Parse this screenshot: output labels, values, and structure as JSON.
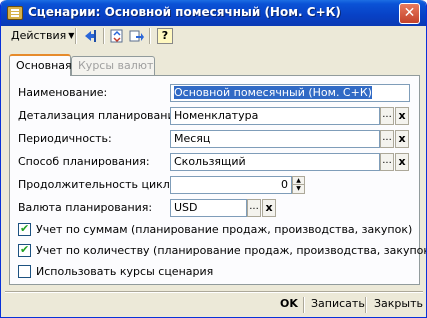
{
  "window": {
    "title": "Сценарии: Основной помесячный (Ном. С+К)",
    "close_glyph": "✕"
  },
  "toolbar": {
    "actions_label": "Действия",
    "help_label": "?"
  },
  "tabs": [
    {
      "label": "Основная",
      "active": true
    },
    {
      "label": "Курсы валют",
      "active": false
    }
  ],
  "form": {
    "name_label": "Наименование:",
    "name_value": "Основной помесячный (Ном. С+К)",
    "detail_label": "Детализация планирования:",
    "detail_value": "Номенклатура",
    "period_label": "Периодичность:",
    "period_value": "Месяц",
    "method_label": "Способ планирования:",
    "method_value": "Скользящий",
    "duration_label": "Продолжительность цикла:",
    "duration_value": "0",
    "currency_label": "Валюта планирования:",
    "currency_value": "USD",
    "ellipsis": "...",
    "clear": "x"
  },
  "checkboxes": [
    {
      "label": "Учет по суммам (планирование продаж, производства, закупок)",
      "checked": true
    },
    {
      "label": "Учет по количеству (планирование продаж, производства, закупок)",
      "checked": true
    },
    {
      "label": "Использовать курсы сценария",
      "checked": false
    }
  ],
  "footer": {
    "ok_label": "OK",
    "save_label": "Записать",
    "close_label": "Закрыть"
  }
}
